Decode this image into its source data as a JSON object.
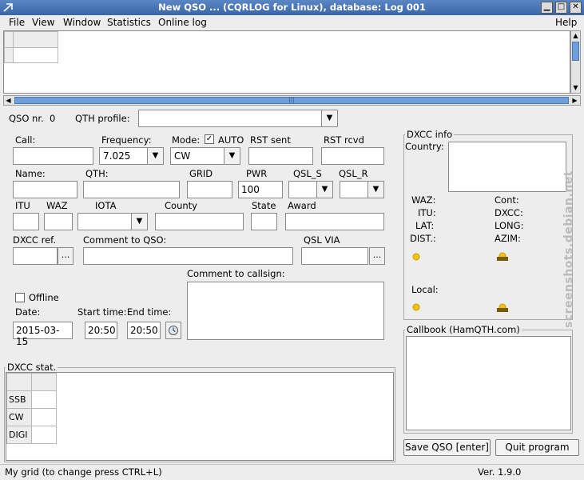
{
  "window": {
    "title": "New QSO ... (CQRLOG for Linux), database: Log 001"
  },
  "menu": {
    "items": [
      "File",
      "View",
      "Window",
      "Statistics",
      "Online log"
    ],
    "help": "Help"
  },
  "qso": {
    "nr_label": "QSO nr.",
    "nr_value": "0",
    "qth_profile_label": "QTH profile:",
    "qth_profile_value": ""
  },
  "fields": {
    "call_label": "Call:",
    "call_value": "",
    "frequency_label": "Frequency:",
    "frequency_value": "7.025",
    "mode_label": "Mode:",
    "mode_value": "CW",
    "auto_label": "AUTO",
    "auto_checked": "✓",
    "rst_sent_label": "RST sent",
    "rst_sent_value": "",
    "rst_rcvd_label": "RST rcvd",
    "rst_rcvd_value": "",
    "name_label": "Name:",
    "qth_label": "QTH:",
    "grid_label": "GRID",
    "pwr_label": "PWR",
    "pwr_value": "100",
    "qsl_s_label": "QSL_S",
    "qsl_r_label": "QSL_R",
    "itu_label": "ITU",
    "waz_label": "WAZ",
    "iota_label": "IOTA",
    "county_label": "County",
    "state_label": "State",
    "award_label": "Award",
    "dxcc_ref_label": "DXCC ref.",
    "comment_qso_label": "Comment to QSO:",
    "qsl_via_label": "QSL VIA",
    "comment_call_label": "Comment to callsign:",
    "offline_label": "Offline",
    "date_label": "Date:",
    "date_value": "2015-03-15",
    "start_time_label": "Start time:",
    "start_time_value": "20:50",
    "end_time_label": "End time:",
    "end_time_value": "20:50",
    "ellipsis": "..."
  },
  "dxcc_info": {
    "title": "DXCC info",
    "country_label": "Country:",
    "waz_label": "WAZ:",
    "itu_label": "ITU:",
    "lat_label": "LAT:",
    "dist_label": "DIST.:",
    "cont_label": "Cont:",
    "dxcc_label": "DXCC:",
    "long_label": "LONG:",
    "azim_label": "AZIM:",
    "local_label": "Local:"
  },
  "dxcc_stat": {
    "title": "DXCC stat.",
    "rows": [
      "SSB",
      "CW",
      "DIGI"
    ]
  },
  "callbook": {
    "title": "Callbook (HamQTH.com)"
  },
  "buttons": {
    "save": "Save QSO [enter]",
    "quit": "Quit program"
  },
  "status": {
    "left": "My grid (to change press CTRL+L)",
    "version": "Ver. 1.9.0"
  },
  "watermark": "screenshots.debian.net"
}
